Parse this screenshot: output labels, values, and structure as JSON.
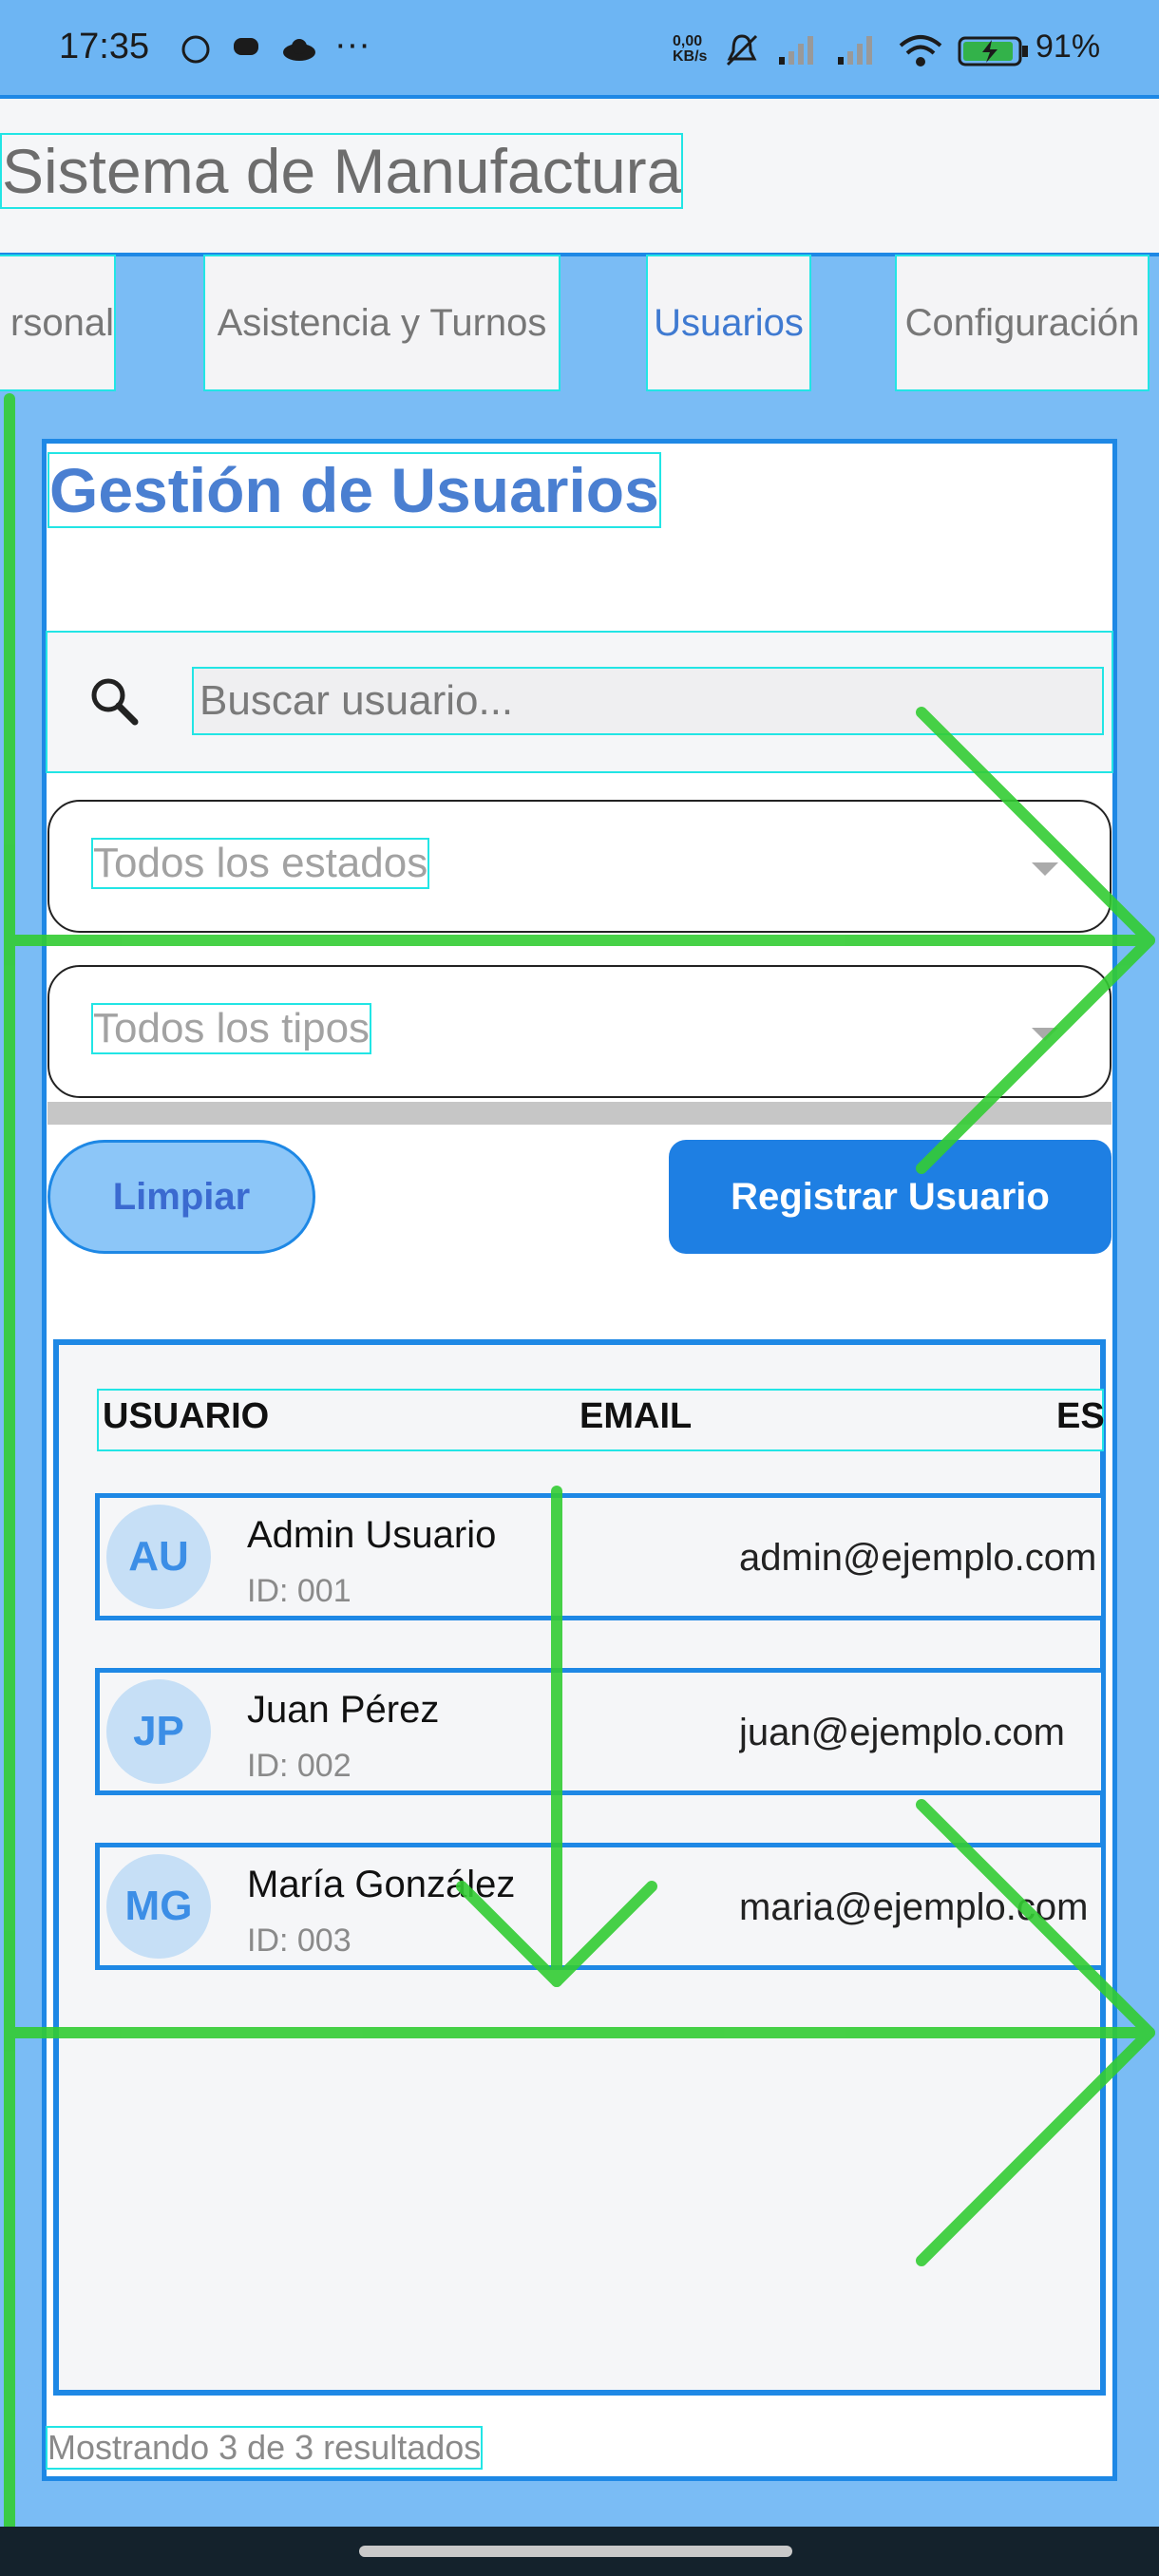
{
  "status_bar": {
    "time": "17:35",
    "icons": [
      "whatsapp-icon",
      "chat-icon",
      "cloud-icon",
      "more-icon",
      "data-speed-icon",
      "mute-icon",
      "signal-icon",
      "signal-icon",
      "wifi-icon",
      "battery-charging-icon"
    ],
    "data_speed": "0,00 KB/s",
    "battery": "91%"
  },
  "app": {
    "title": "Sistema de Manufactura"
  },
  "tabs": [
    {
      "label": "rsonal"
    },
    {
      "label": "Asistencia y Turnos"
    },
    {
      "label": "Usuarios",
      "active": true
    },
    {
      "label": "Configuración"
    }
  ],
  "page": {
    "heading": "Gestión de Usuarios",
    "search": {
      "placeholder": "Buscar usuario...",
      "icon": "search-icon"
    },
    "filter_status": "Todos los estados",
    "filter_type": "Todos los tipos",
    "clear_button": "Limpiar",
    "register_button": "Registrar Usuario"
  },
  "table": {
    "columns": [
      "USUARIO",
      "EMAIL",
      "ES"
    ],
    "rows": [
      {
        "initials": "AU",
        "name": "Admin Usuario",
        "id": "ID: 001",
        "email": "admin@ejemplo.com"
      },
      {
        "initials": "JP",
        "name": "Juan Pérez",
        "id": "ID: 002",
        "email": "juan@ejemplo.com"
      },
      {
        "initials": "MG",
        "name": "María González",
        "id": "ID: 003",
        "email": "maria@ejemplo.com"
      }
    ]
  },
  "footer": {
    "results": "Mostrando 3 de 3 resultados"
  },
  "colors": {
    "accent": "#1e88e5",
    "heading": "#4a7fd1",
    "background": "#7abcf5",
    "overlay_green": "#33cc33",
    "debug_outline": "#22e5e5"
  }
}
